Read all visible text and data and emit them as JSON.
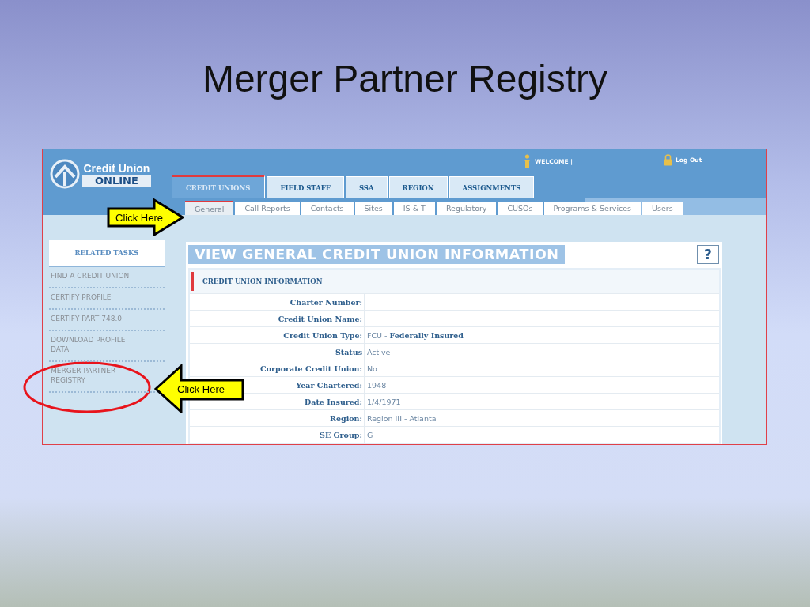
{
  "slide": {
    "title": "Merger Partner Registry"
  },
  "logo": {
    "line_1": "Credit Union",
    "line_2": "ONLINE"
  },
  "top_links": [
    {
      "label": "WELCOME |",
      "kind": "user"
    },
    {
      "label": "Log Out",
      "kind": "lock"
    }
  ],
  "tabs": [
    {
      "label": "CREDIT UNIONS",
      "selected": true
    },
    {
      "label": "FIELD STAFF",
      "selected": false
    },
    {
      "label": "SSA",
      "selected": false
    },
    {
      "label": "REGION",
      "selected": false
    },
    {
      "label": "ASSIGNMENTS",
      "selected": false
    }
  ],
  "subtabs": [
    {
      "label": "General",
      "selected": true
    },
    {
      "label": "Call Reports",
      "selected": false
    },
    {
      "label": "Contacts",
      "selected": false
    },
    {
      "label": "Sites",
      "selected": false
    },
    {
      "label": "IS & T",
      "selected": false
    },
    {
      "label": "Regulatory",
      "selected": false
    },
    {
      "label": "CUSOs",
      "selected": false
    },
    {
      "label": "Programs & Services",
      "selected": false
    },
    {
      "label": "Users",
      "selected": false
    }
  ],
  "sidebar": {
    "title": "RELATED TASKS",
    "items": [
      "FIND A CREDIT UNION",
      "CERTIFY PROFILE",
      "CERTIFY PART 748.0",
      "DOWNLOAD PROFILE DATA",
      "MERGER PARTNER REGISTRY"
    ]
  },
  "panel": {
    "title": "VIEW GENERAL CREDIT UNION INFORMATION",
    "help_button": "?",
    "section": "CREDIT UNION INFORMATION",
    "rows": [
      {
        "label": "Charter Number:"
      },
      {
        "label": "Credit Union Name:"
      },
      {
        "label": "Credit Union Type:",
        "value": "FCU - **Federally Insured**"
      },
      {
        "label": "Status",
        "value": "Active"
      },
      {
        "label": "Corporate Credit Union:",
        "value": "No"
      },
      {
        "label": "Year Chartered:",
        "value": "1948"
      },
      {
        "label": "Date Insured:",
        "value": "1/4/1971"
      },
      {
        "label": "Region:",
        "value": "Region III - Atlanta"
      },
      {
        "label": "SE Group:",
        "value": "G"
      }
    ]
  },
  "callouts": [
    {
      "text": "Click Here",
      "kind": "right-arrow"
    },
    {
      "text": "Click Here",
      "kind": "left-arrow"
    }
  ]
}
